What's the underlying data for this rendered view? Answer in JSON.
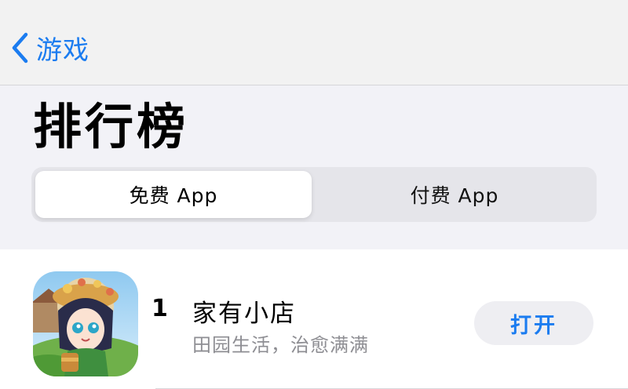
{
  "nav": {
    "back_label": "游戏",
    "back_icon": "chevron-left-icon",
    "accent": "#1b7cf0"
  },
  "header": {
    "title": "排行榜"
  },
  "segments": [
    {
      "label": "免费 App",
      "selected": true
    },
    {
      "label": "付费 App",
      "selected": false
    }
  ],
  "apps": [
    {
      "rank": "1",
      "name": "家有小店",
      "subtitle": "田园生活，治愈满满",
      "action_label": "打开",
      "icon": "game-app-icon"
    }
  ]
}
